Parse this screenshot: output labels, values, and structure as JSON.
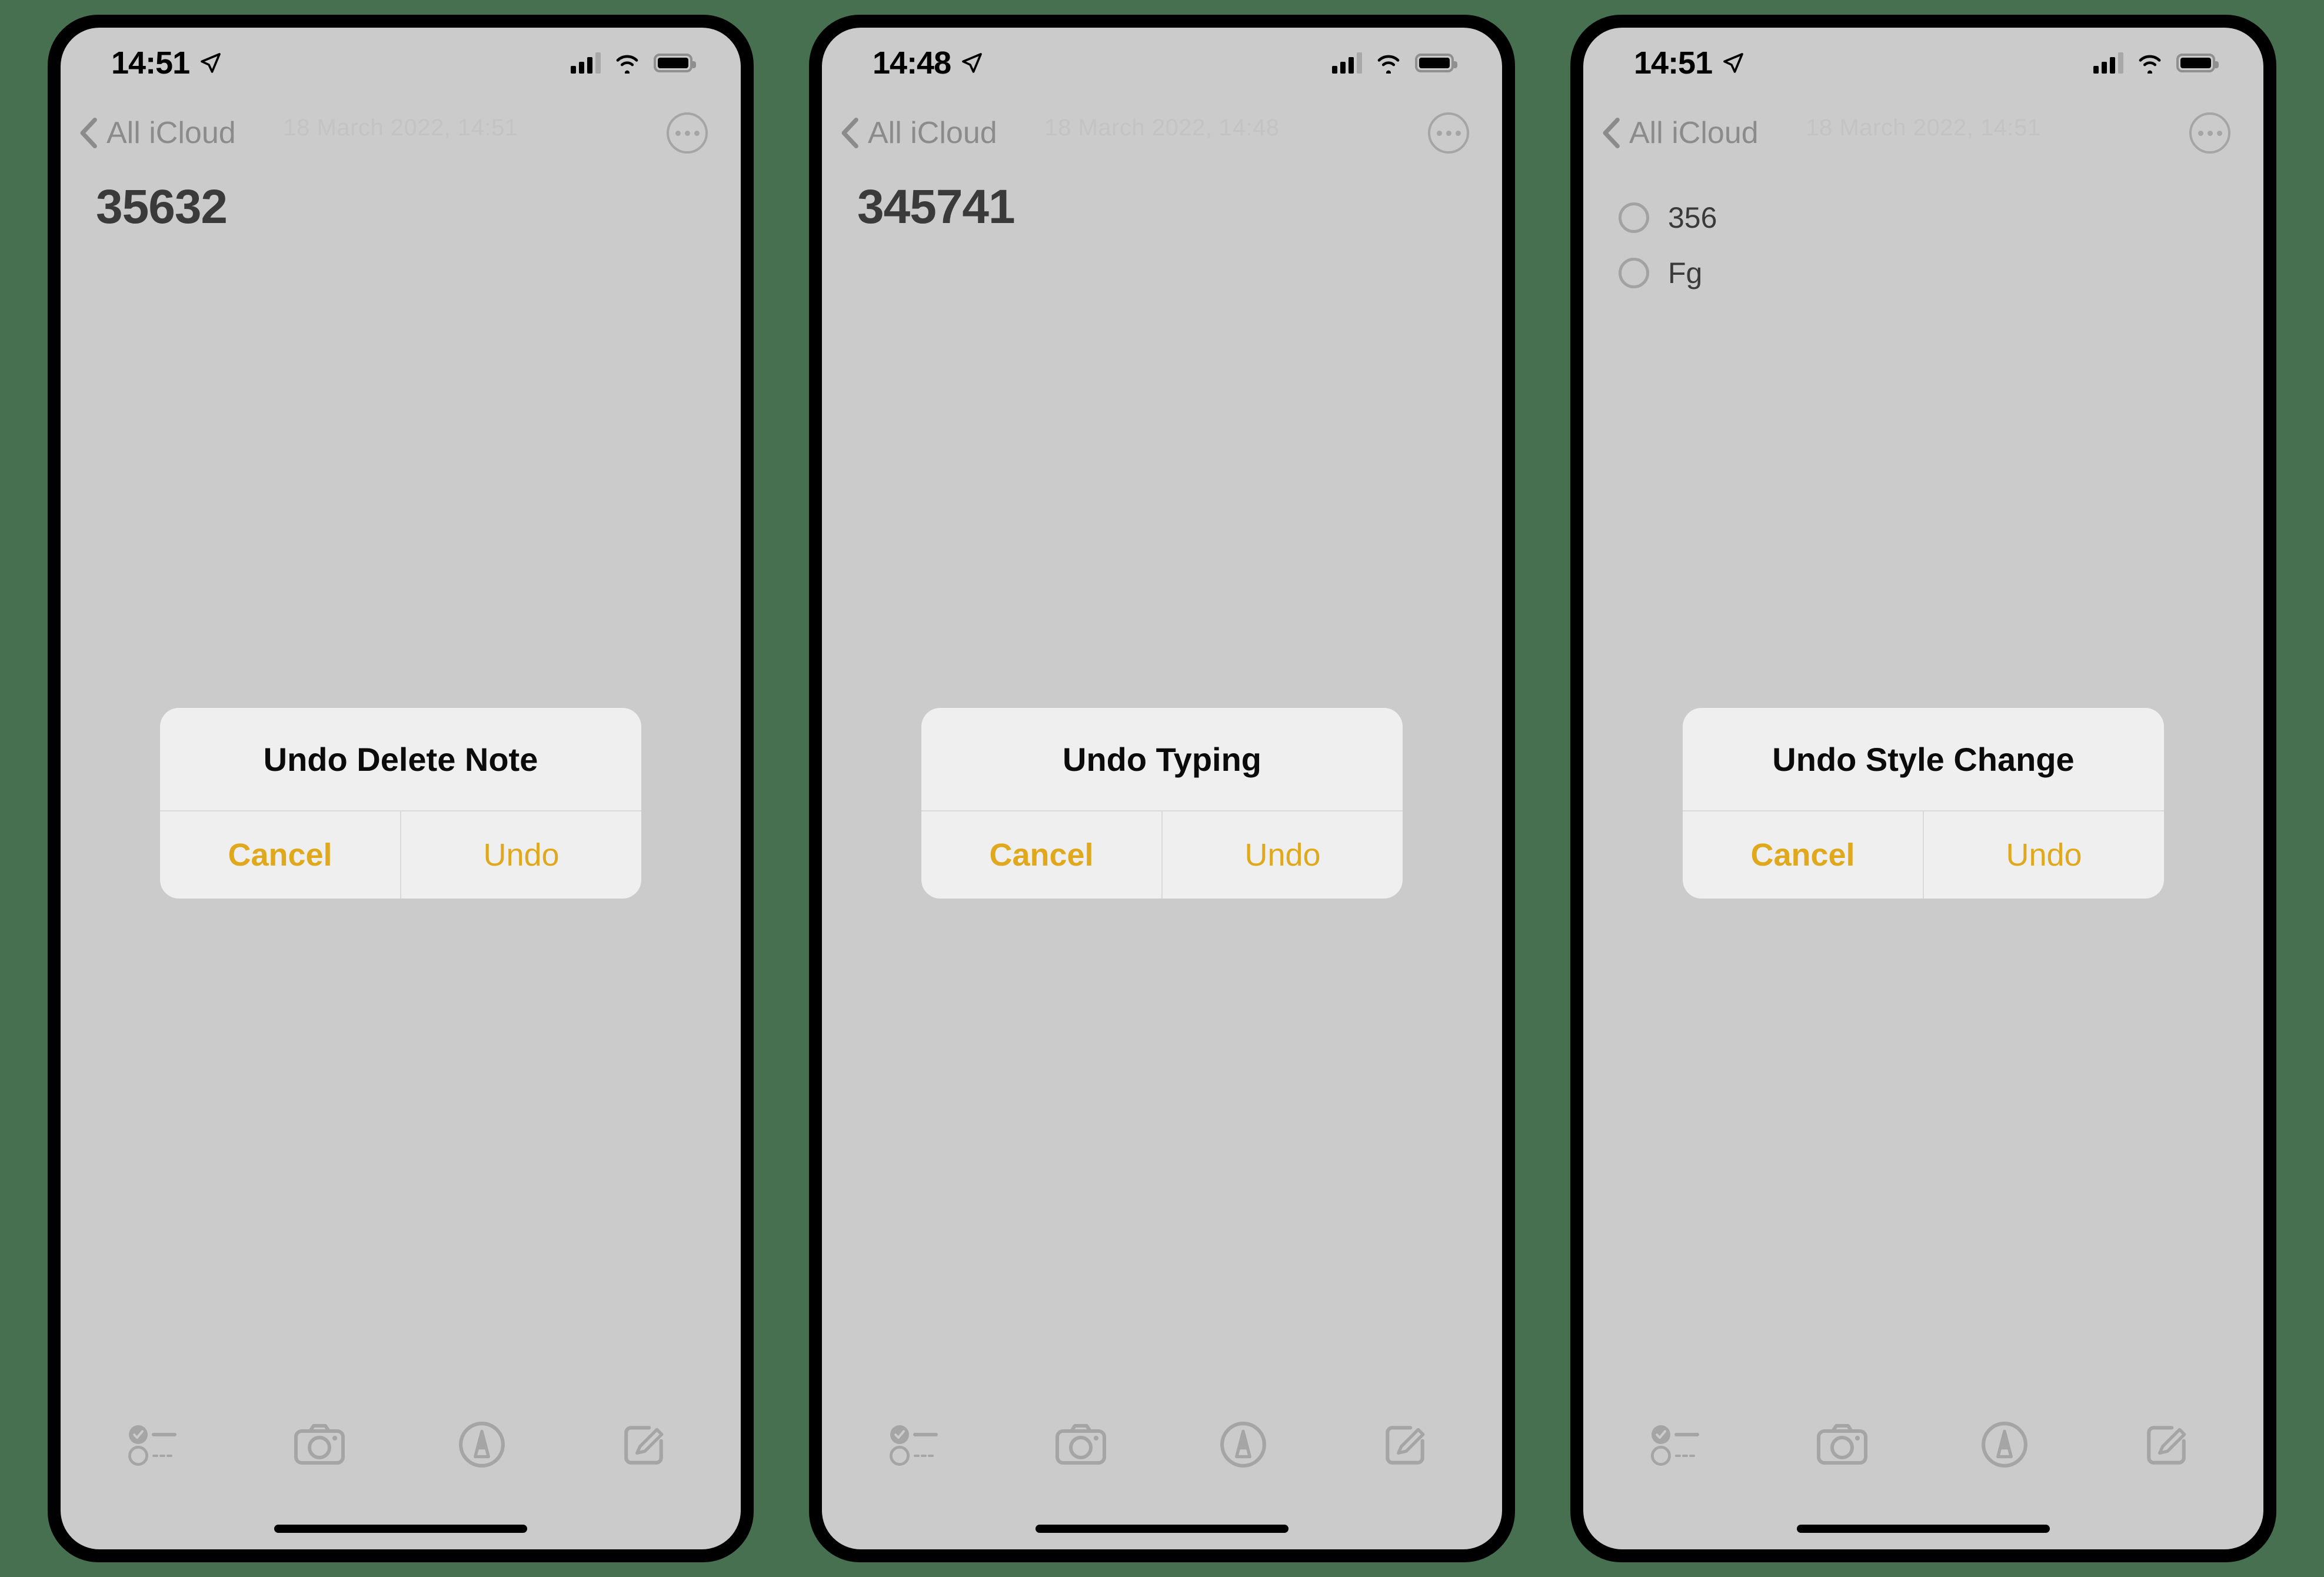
{
  "page": {
    "background_color": "#477050",
    "screen_background": "#cbcbcb",
    "accent_color": "#e0a81c",
    "dialog_background": "#efefef"
  },
  "phones": [
    {
      "status_bar": {
        "time": "14:51",
        "location_icon": "location-arrow-icon",
        "signal_icon": "cellular-signal-icon",
        "wifi_icon": "wifi-icon",
        "battery_icon": "battery-icon"
      },
      "nav_bar": {
        "back_icon": "chevron-left-icon",
        "back_label": "All iCloud",
        "more_icon": "more-ellipsis-icon"
      },
      "watermark_date": "18 March 2022, 14:51",
      "note": {
        "title": "35632",
        "checklist": []
      },
      "dialog": {
        "title": "Undo Delete Note",
        "cancel_label": "Cancel",
        "confirm_label": "Undo"
      },
      "toolbar": [
        {
          "icon": "checklist-icon"
        },
        {
          "icon": "camera-icon"
        },
        {
          "icon": "markup-pen-icon"
        },
        {
          "icon": "compose-icon"
        }
      ]
    },
    {
      "status_bar": {
        "time": "14:48",
        "location_icon": "location-arrow-icon",
        "signal_icon": "cellular-signal-icon",
        "wifi_icon": "wifi-icon",
        "battery_icon": "battery-icon"
      },
      "nav_bar": {
        "back_icon": "chevron-left-icon",
        "back_label": "All iCloud",
        "more_icon": "more-ellipsis-icon"
      },
      "watermark_date": "18 March 2022, 14:48",
      "note": {
        "title": "345741",
        "checklist": []
      },
      "dialog": {
        "title": "Undo Typing",
        "cancel_label": "Cancel",
        "confirm_label": "Undo"
      },
      "toolbar": [
        {
          "icon": "checklist-icon"
        },
        {
          "icon": "camera-icon"
        },
        {
          "icon": "markup-pen-icon"
        },
        {
          "icon": "compose-icon"
        }
      ]
    },
    {
      "status_bar": {
        "time": "14:51",
        "location_icon": "location-arrow-icon",
        "signal_icon": "cellular-signal-icon",
        "wifi_icon": "wifi-icon",
        "battery_icon": "battery-icon"
      },
      "nav_bar": {
        "back_icon": "chevron-left-icon",
        "back_label": "All iCloud",
        "more_icon": "more-ellipsis-icon"
      },
      "watermark_date": "18 March 2022, 14:51",
      "note": {
        "title": "",
        "checklist": [
          {
            "label": "356",
            "checked": false
          },
          {
            "label": "Fg",
            "checked": false
          }
        ]
      },
      "dialog": {
        "title": "Undo Style Change",
        "cancel_label": "Cancel",
        "confirm_label": "Undo"
      },
      "toolbar": [
        {
          "icon": "checklist-icon"
        },
        {
          "icon": "camera-icon"
        },
        {
          "icon": "markup-pen-icon"
        },
        {
          "icon": "compose-icon"
        }
      ]
    }
  ]
}
